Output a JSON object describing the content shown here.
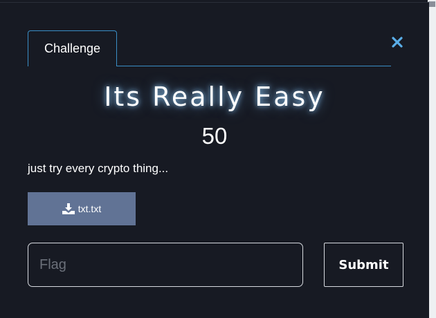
{
  "modal": {
    "tab_label": "Challenge",
    "close_icon": "close-icon",
    "accent_color": "#3a8fc7"
  },
  "challenge": {
    "name": "Its Really Easy",
    "points": "50",
    "description": "just try every crypto thing...",
    "file_name": "txt.txt",
    "file_icon": "download-icon"
  },
  "submission": {
    "flag_placeholder": "Flag",
    "submit_label": "Submit"
  }
}
